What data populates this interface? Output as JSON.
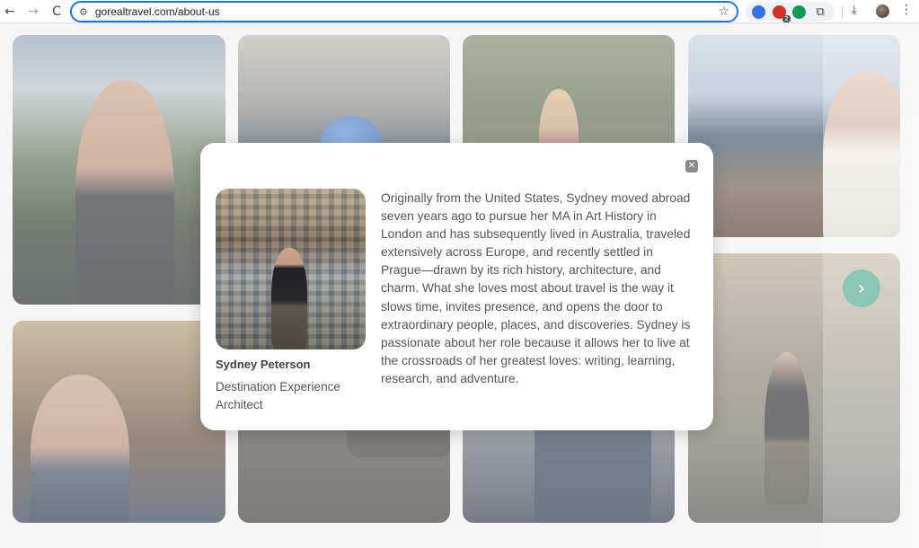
{
  "browser": {
    "url": "gorealtravel.com/about-us",
    "back_icon": "←",
    "forward_icon": "→",
    "reload_icon": "C",
    "site_settings_icon": "⚙",
    "star_icon": "☆",
    "ext_badge": "2",
    "puzzle_icon": "⧉",
    "download_icon": "⤓",
    "menu_icon": "⋮"
  },
  "colors": {
    "accent_blue": "#1a73e8",
    "next_button": "#0f8a6a"
  },
  "gallery": {
    "next_icon": "›"
  },
  "modal": {
    "close_icon": "✕",
    "name": "Sydney Peterson",
    "role": "Destination Experience Architect",
    "bio": "Originally from the United States, Sydney moved abroad seven years ago to pursue her MA in Art History in London and has subsequently lived in Australia, traveled extensively across Europe, and recently settled in Prague—drawn by its rich history, architecture, and charm. What she loves most about travel is the way it slows time, invites presence, and opens the door to extraordinary people, places, and discoveries. Sydney is passionate about her role because it allows her to live at the crossroads of her greatest loves: writing, learning, research, and adventure."
  }
}
